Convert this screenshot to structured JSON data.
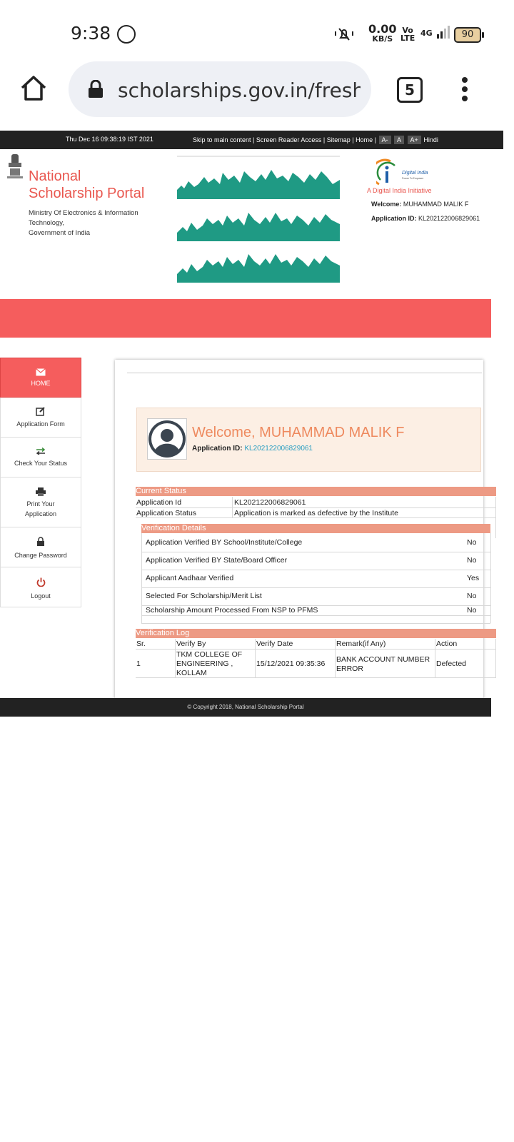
{
  "status_bar": {
    "time": "9:38",
    "net_speed": "0.00",
    "net_unit": "KB/S",
    "volte": "Vo\nLTE",
    "network": "4G",
    "battery": "90"
  },
  "browser": {
    "url": "scholarships.gov.in/fresh/c",
    "tab_count": "5"
  },
  "topbar": {
    "datetime": "Thu Dec 16 09:38:19 IST 2021",
    "links": "Skip to main content | Screen Reader Access | Sitemap | Home |",
    "font_small": "A-",
    "font_normal": "A",
    "font_large": "A+",
    "lang": "Hindi"
  },
  "header": {
    "title_line1": "National",
    "title_line2": "Scholarship Portal",
    "ministry_line1": "Ministry Of Electronics & Information",
    "ministry_line2": "Technology,",
    "ministry_line3": "Government of India",
    "digital_india": "Digital India",
    "digital_india_sub": "Power To Empower",
    "digital_india_tag": "A Digital India Initiative",
    "welcome_label": "Welcome:",
    "welcome_name": "MUHAMMAD MALIK F",
    "appid_label": "Application ID:",
    "appid_value": "KL202122006829061"
  },
  "sidebar": {
    "items": [
      {
        "label": "HOME"
      },
      {
        "label": "Application Form"
      },
      {
        "label": "Check Your Status"
      },
      {
        "label": "Print Your Application"
      },
      {
        "label": "Change Password"
      },
      {
        "label": "Logout"
      }
    ]
  },
  "welcome": {
    "greeting": "Welcome, MUHAMMAD MALIK F",
    "appid_label": "Application ID:",
    "appid_value": "KL202122006829061"
  },
  "current_status": {
    "heading": "Current Status",
    "rows": [
      {
        "label": "Application Id",
        "value": "KL202122006829061"
      },
      {
        "label": "Application Status",
        "value": "Application is marked as defective by the Institute"
      }
    ]
  },
  "verification_details": {
    "heading": "Verification Details",
    "rows": [
      {
        "label": "Application Verified BY School/Institute/College",
        "value": "No"
      },
      {
        "label": "Application Verified BY State/Board Officer",
        "value": "No"
      },
      {
        "label": "Applicant Aadhaar Verified",
        "value": "Yes"
      },
      {
        "label": "Selected For Scholarship/Merit List",
        "value": "No"
      },
      {
        "label": "Scholarship Amount Processed From NSP to PFMS",
        "value": "No"
      }
    ]
  },
  "verification_log": {
    "heading": "Verification Log",
    "columns": [
      "Sr.",
      "Verify By",
      "Verify Date",
      "Remark(if Any)",
      "Action"
    ],
    "row": {
      "sr": "1",
      "verify_by_1": "TKM COLLEGE OF",
      "verify_by_2": "ENGINEERING ,",
      "verify_by_3": "KOLLAM",
      "date": "15/12/2021 09:35:36",
      "remark_1": "BANK ACCOUNT NUMBER",
      "remark_2": "ERROR",
      "action": "Defected"
    }
  },
  "footer": {
    "copyright": "© Copyright 2018, National Scholarship Portal"
  }
}
